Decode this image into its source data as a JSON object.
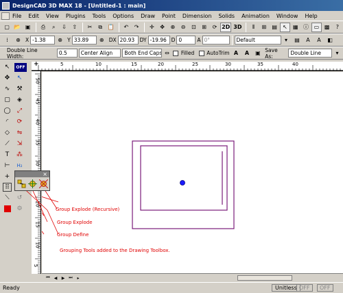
{
  "window": {
    "title": "DesignCAD 3D MAX 18 - [Untitled-1 : main]"
  },
  "menu": [
    "File",
    "Edit",
    "View",
    "Plugins",
    "Tools",
    "Options",
    "Draw",
    "Point",
    "Dimension",
    "Solids",
    "Animation",
    "Window",
    "Help"
  ],
  "toolbar": {
    "view_2d": "2D",
    "view_3d": "3D"
  },
  "coords": {
    "x_label": "X",
    "x_value": "-1.38",
    "y_label": "Y",
    "y_value": "33.89",
    "dx_label": "DX",
    "dx_value": "20.93",
    "dy_label": "DY",
    "dy_value": "-19.96",
    "d_label": "D",
    "d_value": "0",
    "a_label": "A",
    "a_value": "0°",
    "layer_value": "Default"
  },
  "lineopts": {
    "width_label": "Double Line Width:",
    "width_value": "0.5",
    "align_value": "Center Align",
    "caps_value": "Both End Caps",
    "filled_label": "Filled",
    "autotrim_label": "AutoTrim",
    "saveas_label": "Save As:",
    "saveas_value": "Double Line"
  },
  "toolbox": {
    "off_label": "OFF"
  },
  "ruler": {
    "top_ticks": [
      "5",
      "10",
      "15",
      "20",
      "25",
      "30",
      "35",
      "40"
    ],
    "left_ticks": [
      "50",
      "45",
      "40",
      "35",
      "30",
      "25",
      "20",
      "15",
      "10",
      "5"
    ]
  },
  "annotations": {
    "explode_recursive": "Group Explode (Recursive)",
    "explode": "Group Explode",
    "define": "Group Define",
    "caption": "Grouping Tools added to the Drawing Toolbox."
  },
  "popup": {
    "close": "×"
  },
  "status": {
    "ready": "Ready",
    "units": "Unitless",
    "off1": "OFF",
    "off2": "OFF"
  },
  "colors": {
    "rect_color": "#7a1a7a",
    "annotation_color": "#e00000",
    "point_color": "#1a1aff"
  }
}
